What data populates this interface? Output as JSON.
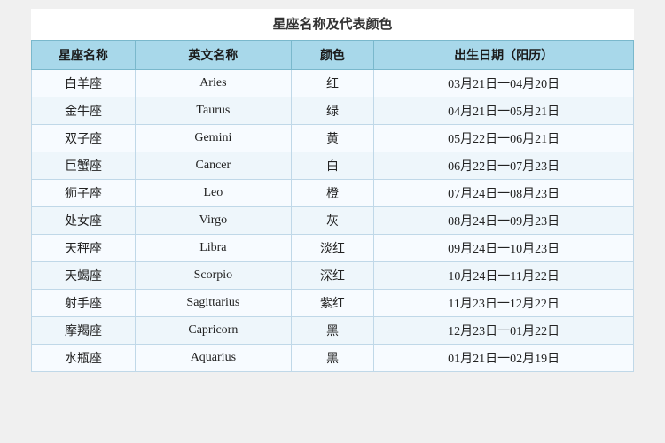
{
  "title": "星座名称及代表颜色",
  "headers": {
    "zh_name": "星座名称",
    "en_name": "英文名称",
    "color": "颜色",
    "date": "出生日期（阳历）"
  },
  "rows": [
    {
      "zh": "白羊座",
      "en": "Aries",
      "color": "红",
      "date": "03月21日一04月20日"
    },
    {
      "zh": "金牛座",
      "en": "Taurus",
      "color": "绿",
      "date": "04月21日一05月21日"
    },
    {
      "zh": "双子座",
      "en": "Gemini",
      "color": "黄",
      "date": "05月22日一06月21日"
    },
    {
      "zh": "巨蟹座",
      "en": "Cancer",
      "color": "白",
      "date": "06月22日一07月23日"
    },
    {
      "zh": "狮子座",
      "en": "Leo",
      "color": "橙",
      "date": "07月24日一08月23日"
    },
    {
      "zh": "处女座",
      "en": "Virgo",
      "color": "灰",
      "date": "08月24日一09月23日"
    },
    {
      "zh": "天秤座",
      "en": "Libra",
      "color": "淡红",
      "date": "09月24日一10月23日"
    },
    {
      "zh": "天蝎座",
      "en": "Scorpio",
      "color": "深红",
      "date": "10月24日一11月22日"
    },
    {
      "zh": "射手座",
      "en": "Sagittarius",
      "color": "紫红",
      "date": "11月23日一12月22日"
    },
    {
      "zh": "摩羯座",
      "en": "Capricorn",
      "color": "黑",
      "date": "12月23日一01月22日"
    },
    {
      "zh": "水瓶座",
      "en": "Aquarius",
      "color": "黑",
      "date": "01月21日一02月19日"
    }
  ]
}
